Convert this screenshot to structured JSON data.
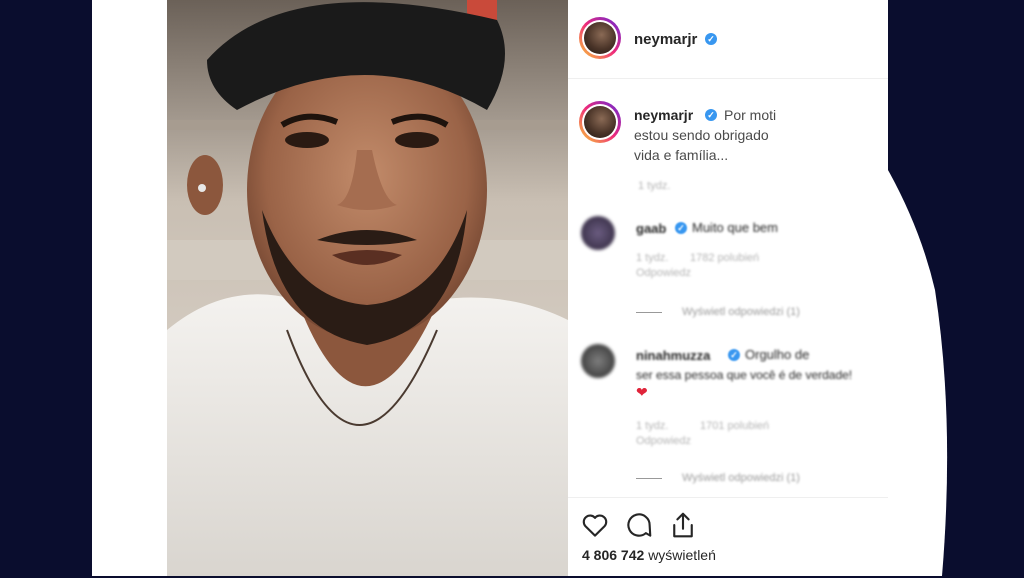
{
  "post": {
    "author": "neymarjr",
    "caption_user": "neymarjr",
    "caption_line1": "Por moti",
    "caption_line2": "estou sendo obrigado",
    "caption_line3": "vida e família...",
    "caption_time": "1 tydz."
  },
  "comments": [
    {
      "username": "gaab",
      "text": "Muito que bem",
      "time": "1 tydz.",
      "likes": "1782 polubień",
      "reply_label": "Odpowiedz",
      "view_replies": "Wyświetl odpowiedzi (1)"
    },
    {
      "username": "ninahmuzza",
      "text_line1": "Orgulho de",
      "text_line2": "ser essa pessoa que você é de verdade!",
      "time": "1 tydz.",
      "likes": "1701 polubień",
      "reply_label": "Odpowiedz",
      "view_replies": "Wyświetl odpowiedzi (1)"
    }
  ],
  "stats": {
    "views_count": "4 806 742",
    "views_label": "wyświetleń"
  },
  "icons": [
    "heart-icon",
    "comment-icon",
    "share-icon",
    "verified-badge-icon"
  ],
  "colors": {
    "verified": "#3897f0",
    "heart": "#e0243a",
    "background": "#0a0d2e"
  }
}
